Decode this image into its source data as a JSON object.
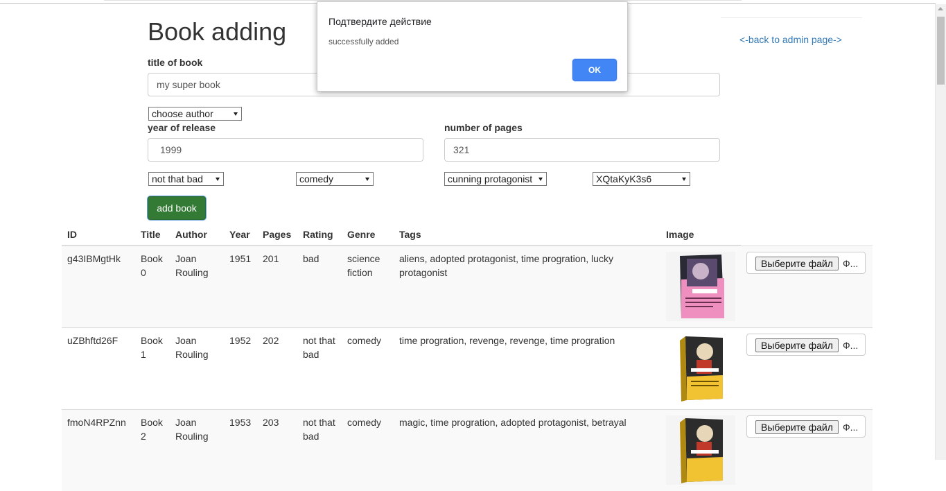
{
  "page": {
    "title": "Book adding",
    "back_link": "<-back to admin page->"
  },
  "form": {
    "title_label": "title of book",
    "title_value": "my super book",
    "author_select": "choose author",
    "year_label": "year of release",
    "year_value": "1999",
    "pages_label": "number of pages",
    "pages_value": "321",
    "rating_select": "not that bad",
    "genre_select": "comedy",
    "tag_select": "cunning protagonist",
    "image_select": "XQtaKyK3s6",
    "submit_label": "add book"
  },
  "table": {
    "headers": [
      "ID",
      "Title",
      "Author",
      "Year",
      "Pages",
      "Rating",
      "Genre",
      "Tags",
      "Image"
    ],
    "file_button_label": "Выберите файл",
    "file_status": "Ф...",
    "rows": [
      {
        "id": "g43IBMgtHk",
        "title_1": "Book",
        "title_2": "0",
        "author_1": "Joan",
        "author_2": "Rouling",
        "year": "1951",
        "pages": "201",
        "rating_1": "bad",
        "rating_2": "",
        "genre_1": "science",
        "genre_2": "fiction",
        "tags_1": "aliens, adopted protagonist, time progration, lucky",
        "tags_2": "protagonist",
        "cover": "pink-book-cover-icon"
      },
      {
        "id": "uZBhftd26F",
        "title_1": "Book",
        "title_2": "1",
        "author_1": "Joan",
        "author_2": "Rouling",
        "year": "1952",
        "pages": "202",
        "rating_1": "not that",
        "rating_2": "bad",
        "genre_1": "comedy",
        "genre_2": "",
        "tags_1": "time progration, revenge, revenge, time progration",
        "tags_2": "",
        "cover": "yellow-book-cover-icon"
      },
      {
        "id": "fmoN4RPZnn",
        "title_1": "Book",
        "title_2": "2",
        "author_1": "Joan",
        "author_2": "Rouling",
        "year": "1953",
        "pages": "203",
        "rating_1": "not that",
        "rating_2": "bad",
        "genre_1": "comedy",
        "genre_2": "",
        "tags_1": "magic, time progration, adopted protagonist, betrayal",
        "tags_2": "",
        "cover": "yellow-book-cover-icon"
      }
    ]
  },
  "dialog": {
    "title": "Подтвердите действие",
    "message": "successfully added",
    "ok_label": "OK"
  },
  "colors": {
    "accent_green": "#337a35",
    "link_blue": "#337ab7",
    "dialog_button": "#4285f4"
  }
}
